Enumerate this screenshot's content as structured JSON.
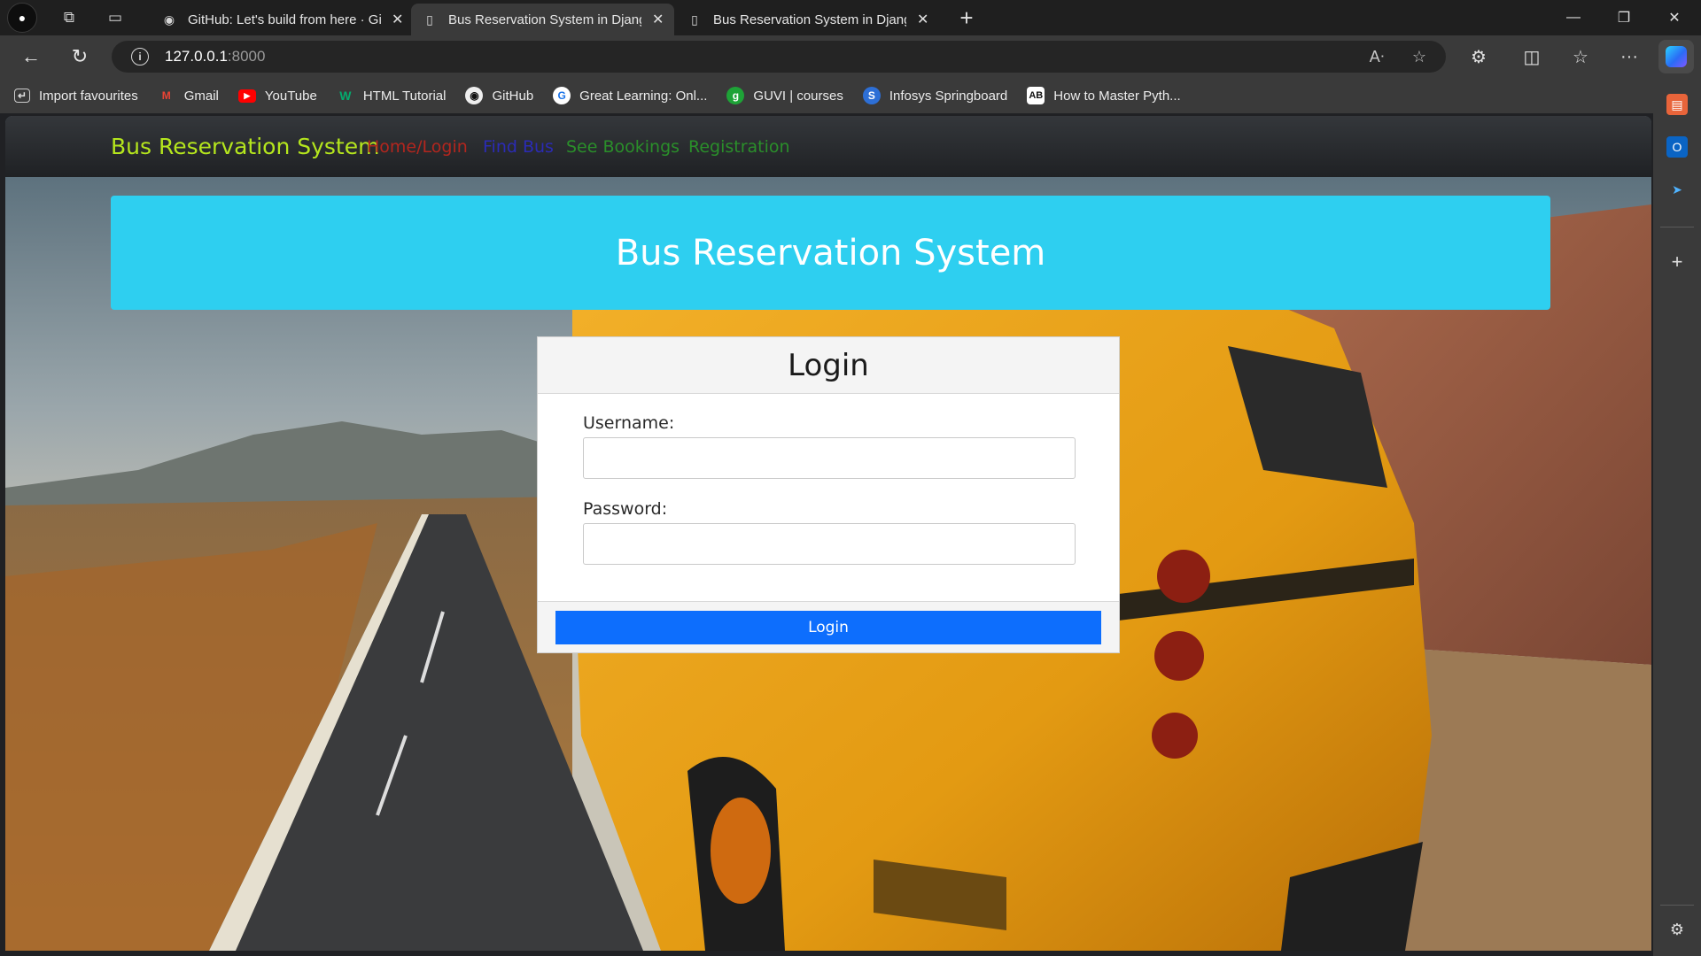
{
  "browser": {
    "tabs": [
      {
        "title": "GitHub: Let's build from here · GitHub",
        "icon": "github-icon",
        "active": false
      },
      {
        "title": "Bus Reservation System in Django",
        "icon": "page-icon",
        "active": true
      },
      {
        "title": "Bus Reservation System in Django",
        "icon": "page-icon",
        "active": false
      }
    ],
    "url_host": "127.0.0.1",
    "url_port": ":8000",
    "bookmarks": [
      {
        "label": "Import favourites",
        "icon": "import-icon"
      },
      {
        "label": "Gmail",
        "icon": "gmail-icon"
      },
      {
        "label": "YouTube",
        "icon": "youtube-icon"
      },
      {
        "label": "HTML Tutorial",
        "icon": "w3schools-icon"
      },
      {
        "label": "GitHub",
        "icon": "github-icon"
      },
      {
        "label": "Great Learning: Onl...",
        "icon": "great-learning-icon"
      },
      {
        "label": "GUVI | courses",
        "icon": "guvi-icon"
      },
      {
        "label": "Infosys Springboard",
        "icon": "infosys-icon"
      },
      {
        "label": "How to Master Pyth...",
        "icon": "ab-icon"
      }
    ]
  },
  "site": {
    "brand": "Bus Reservation System",
    "nav": [
      {
        "label": "Home/Login",
        "color": "#b3261e"
      },
      {
        "label": "Find Bus",
        "color": "#2b2bb5"
      },
      {
        "label": "See Bookings",
        "color": "#2a8f2a"
      },
      {
        "label": "Registration",
        "color": "#2a8f2a"
      }
    ],
    "hero_title": "Bus Reservation System",
    "login": {
      "title": "Login",
      "username_label": "Username:",
      "password_label": "Password:",
      "username_value": "",
      "password_value": "",
      "button": "Login"
    }
  },
  "colors": {
    "brand": "#b5e61d",
    "hero": "#2ecff0",
    "button": "#0d6efd"
  }
}
